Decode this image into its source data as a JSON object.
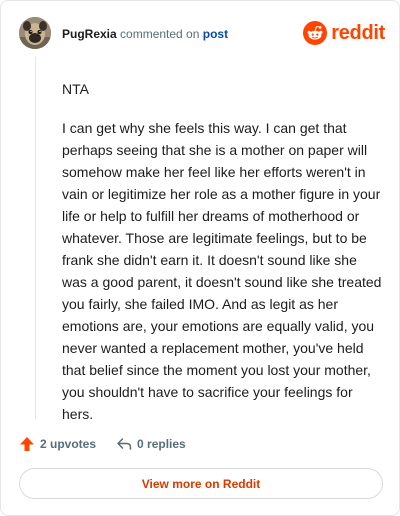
{
  "header": {
    "username": "PugRexia",
    "action_text": "commented on",
    "post_link": "post",
    "brand_text": "reddit"
  },
  "comment": {
    "paragraphs": [
      "NTA",
      "I can get why she feels this way. I can get that perhaps seeing that she is a mother on paper will somehow make her feel like her efforts weren't in vain or legitimize her role as a mother figure in your life or help to fulfill her dreams of motherhood or whatever. Those are legitimate feelings, but to be frank she didn't earn it. It doesn't sound like she was a good parent, it doesn't sound like she treated you fairly, she failed IMO. And as legit as her emotions are, your emotions are equally valid, you never wanted a replacement mother, you've held that belief since the moment you lost your mother, you shouldn't have to sacrifice your feelings for hers."
    ]
  },
  "footer": {
    "upvotes": "2 upvotes",
    "replies": "0 replies",
    "view_more": "View more on Reddit"
  },
  "icons": {
    "brand": "reddit-alien-icon",
    "upvote": "upvote-arrow-icon",
    "reply": "reply-arrow-icon",
    "avatar": "pug-avatar"
  },
  "colors": {
    "brand_orange": "#ff4500",
    "link_blue": "#0a4aa6",
    "muted_text": "#576f76",
    "button_text": "#d93a00"
  }
}
